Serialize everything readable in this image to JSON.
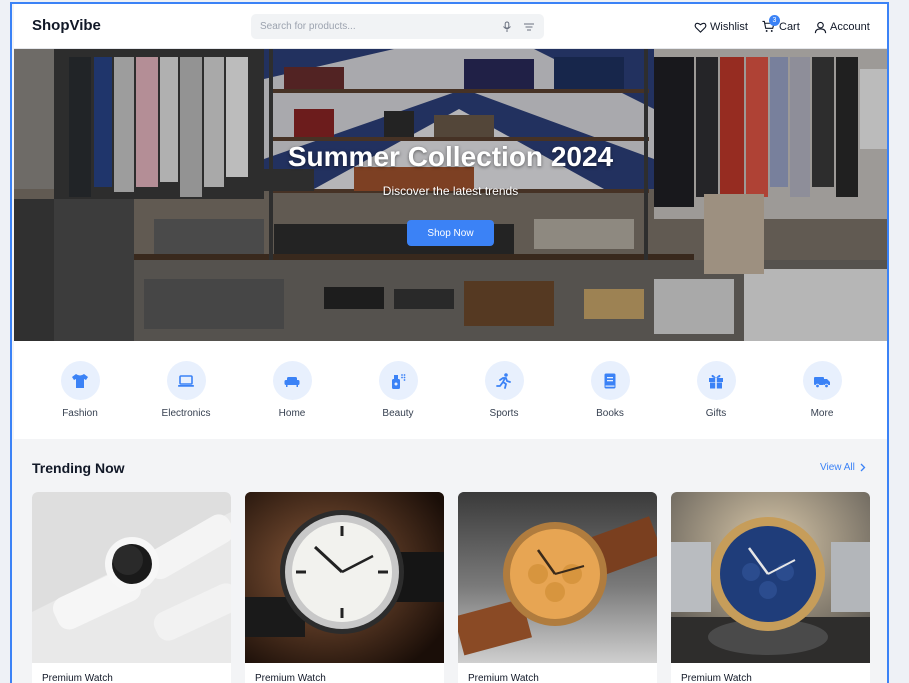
{
  "header": {
    "logo": "ShopVibe",
    "search_placeholder": "Search for products...",
    "wishlist_label": "Wishlist",
    "cart_label": "Cart",
    "cart_count": "3",
    "account_label": "Account"
  },
  "hero": {
    "title": "Summer Collection 2024",
    "subtitle": "Discover the latest trends",
    "button_label": "Shop Now"
  },
  "categories": [
    {
      "label": "Fashion",
      "icon": "shirt-icon"
    },
    {
      "label": "Electronics",
      "icon": "laptop-icon"
    },
    {
      "label": "Home",
      "icon": "couch-icon"
    },
    {
      "label": "Beauty",
      "icon": "spray-bottle-icon"
    },
    {
      "label": "Sports",
      "icon": "running-icon"
    },
    {
      "label": "Books",
      "icon": "book-icon"
    },
    {
      "label": "Gifts",
      "icon": "gift-icon"
    },
    {
      "label": "More",
      "icon": "truck-icon"
    }
  ],
  "trending": {
    "title": "Trending Now",
    "view_all_label": "View All",
    "products": [
      {
        "name": "Premium Watch"
      },
      {
        "name": "Premium Watch"
      },
      {
        "name": "Premium Watch"
      },
      {
        "name": "Premium Watch"
      }
    ]
  },
  "colors": {
    "accent": "#3b82f6",
    "icon_bg": "#e8f0fd"
  }
}
